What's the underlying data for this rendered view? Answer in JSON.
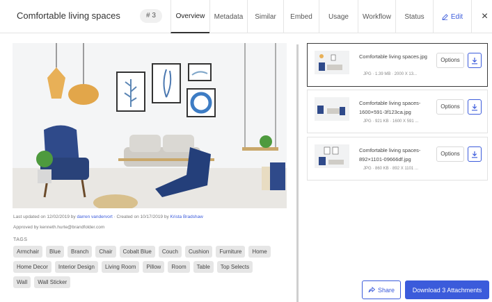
{
  "header": {
    "title": "Comfortable living spaces",
    "count_badge": "# 3",
    "tabs": [
      {
        "label": "Overview"
      },
      {
        "label": "Metadata"
      },
      {
        "label": "Similar"
      },
      {
        "label": "Embed"
      },
      {
        "label": "Usage"
      },
      {
        "label": "Workflow"
      },
      {
        "label": "Status"
      }
    ],
    "edit_label": "Edit",
    "edit_icon": "pencil-icon",
    "close_label": "×"
  },
  "preview": {
    "updated_prefix": "Last updated on 12/02/2019 by",
    "updated_by": "darren vandervort",
    "created_prefix": "· Created on 10/17/2019 by",
    "created_by": "Krista Bradshaw",
    "approved": "Approved by kenneth.hurte@brandfolder.com"
  },
  "tags": {
    "label": "TAGS",
    "items": [
      "Armchair",
      "Blue",
      "Branch",
      "Chair",
      "Cobalt Blue",
      "Couch",
      "Cushion",
      "Furniture",
      "Home",
      "Home Decor",
      "Interior Design",
      "Living Room",
      "Pillow",
      "Room",
      "Table",
      "Top Selects",
      "Wall",
      "Wall Sticker"
    ]
  },
  "attachments": [
    {
      "name": "Comfortable living spaces.jpg",
      "meta": "JPG · 1.39 MB · 2000 X 13...",
      "options": "Options"
    },
    {
      "name": "Comfortable living spaces-1600×591-3f123ca.jpg",
      "meta": "JPG · 921 KB · 1600 X 591 ...",
      "options": "Options"
    },
    {
      "name": "Comfortable living spaces-892×1101-09666df.jpg",
      "meta": "JPG · 860 KB · 892 X 1101 ...",
      "options": "Options"
    }
  ],
  "actions": {
    "share_label": "Share",
    "download_all_label": "Download 3 Attachments"
  },
  "colors": {
    "accent": "#3b5bdb",
    "chair": "#2f4a8a",
    "sofa": "#d8d6d0",
    "lamp": "#e8b057"
  }
}
